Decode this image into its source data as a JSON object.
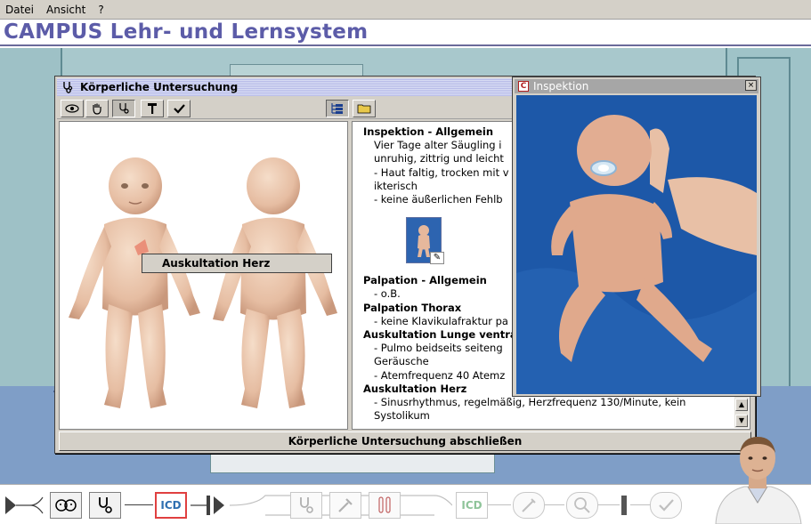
{
  "menu": [
    "Datei",
    "Ansicht",
    "?"
  ],
  "app_title": "CAMPUS Lehr- und Lernsystem",
  "exam_window": {
    "title": "Körperliche Untersuchung",
    "toolbar": [
      "eye-icon",
      "hand-icon",
      "stethoscope-icon",
      "hammer-icon",
      "check-icon",
      "tree-view-icon",
      "folder-icon"
    ],
    "context_menu_item": "Auskultation Herz",
    "findings": [
      {
        "heading": "Inspektion - Allgemein",
        "lines": [
          "Vier Tage alter Säugling i",
          "unruhig, zittrig und leicht",
          "- Haut faltig, trocken mit v",
          "ikterisch",
          "- keine äußerlichen Fehlb"
        ]
      },
      {
        "heading": "Palpation - Allgemein",
        "lines": [
          "- o.B."
        ]
      },
      {
        "heading": "Palpation Thorax",
        "lines": [
          "- keine Klavikulafraktur pa"
        ]
      },
      {
        "heading": "Auskultation Lunge ventra",
        "lines": [
          "- Pulmo beidseits seiteng",
          "Geräusche",
          "- Atemfrequenz 40 Atemz"
        ]
      },
      {
        "heading": "Auskultation Herz",
        "lines": [
          "- Sinusrhythmus, regelmäßig, Herzfrequenz 130/Minute, kein",
          "Systolikum"
        ]
      }
    ],
    "finish_button": "Körperliche Untersuchung abschließen"
  },
  "inspection_window": {
    "title": "Inspektion",
    "close": "×"
  },
  "nav": {
    "icd_label": "ICD",
    "icd_label_2": "ICD"
  },
  "colors": {
    "title_text": "#5c5ca8",
    "photo_bg": "#1d58a8",
    "icd_border": "#e04040"
  }
}
